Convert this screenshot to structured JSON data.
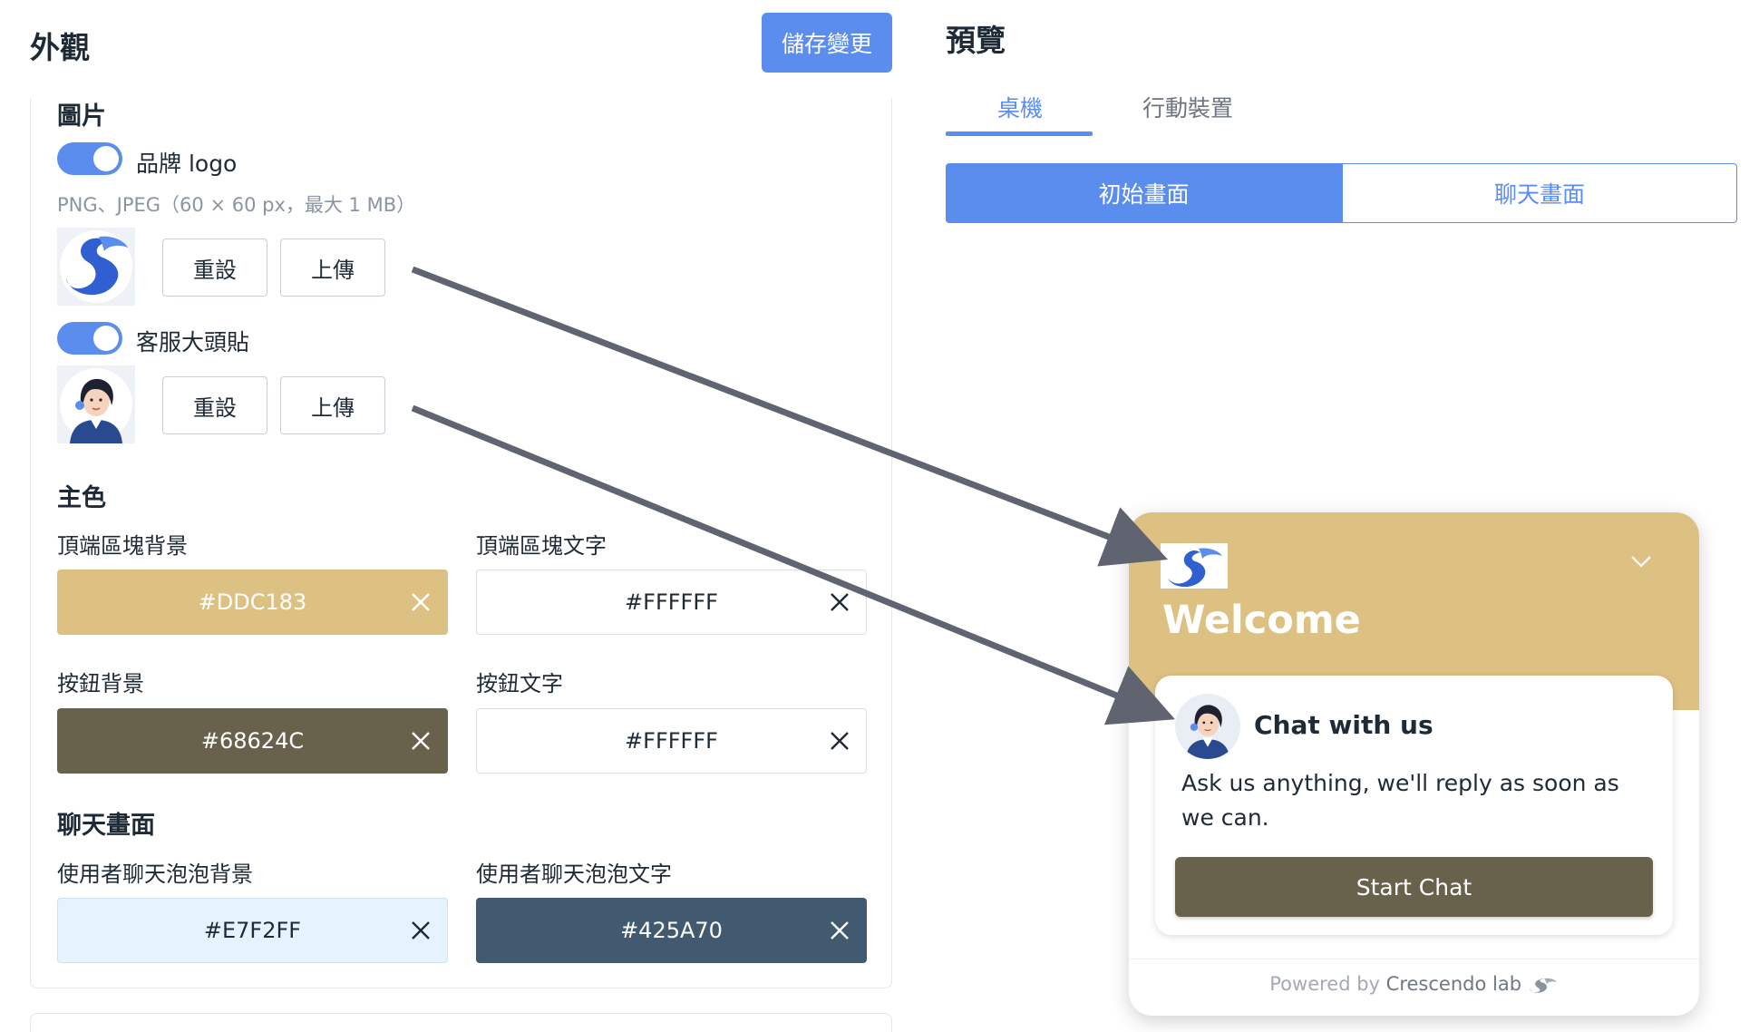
{
  "header": {
    "title": "外觀",
    "save_label": "儲存變更"
  },
  "images": {
    "section_title": "圖片",
    "logo_toggle_label": "品牌 logo",
    "logo_hint": "PNG、JPEG（60 × 60 px，最大 1 MB）",
    "avatar_toggle_label": "客服大頭貼",
    "reset_label": "重設",
    "upload_label": "上傳"
  },
  "primary": {
    "section_title": "主色",
    "header_bg_label": "頂端區塊背景",
    "header_bg_value": "#DDC183",
    "header_text_label": "頂端區塊文字",
    "header_text_value": "#FFFFFF",
    "button_bg_label": "按鈕背景",
    "button_bg_value": "#68624C",
    "button_text_label": "按鈕文字",
    "button_text_value": "#FFFFFF"
  },
  "chat": {
    "section_title": "聊天畫面",
    "bubble_bg_label": "使用者聊天泡泡背景",
    "bubble_bg_value": "#E7F2FF",
    "bubble_text_label": "使用者聊天泡泡文字",
    "bubble_text_value": "#425A70"
  },
  "preview": {
    "title": "預覽",
    "tabs": [
      "桌機",
      "行動裝置"
    ],
    "segments": [
      "初始畫面",
      "聊天畫面"
    ],
    "widget": {
      "welcome": "Welcome",
      "card_title": "Chat with us",
      "card_desc": "Ask us anything, we'll reply as soon as we can.",
      "start_label": "Start Chat",
      "powered_prefix": "Powered by",
      "powered_brand": "Crescendo lab"
    }
  },
  "colors": {
    "accent": "#5b8def",
    "header_bg": "#DDC183",
    "button_bg": "#68624C",
    "bubble_bg": "#E7F2FF",
    "bubble_text": "#425A70",
    "arrow": "#5f6470"
  },
  "icons": {
    "clear": "close-icon",
    "collapse": "chevron-down-icon",
    "logo": "brand-logo-icon",
    "avatar": "agent-avatar-icon"
  }
}
